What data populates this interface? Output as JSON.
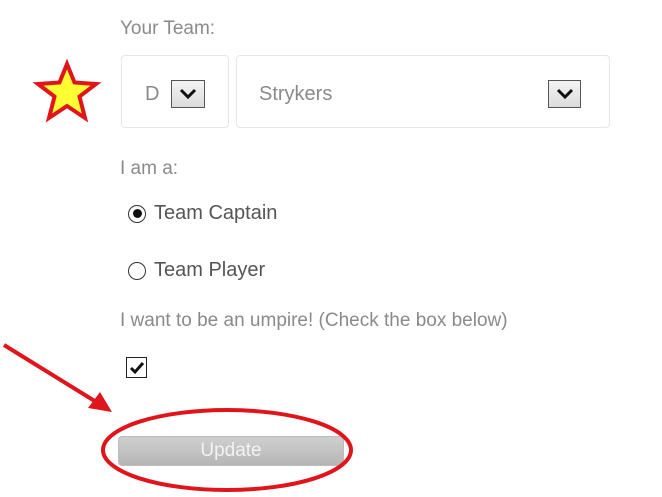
{
  "form": {
    "team_label": "Your Team:",
    "division_value": "D",
    "team_value": "Strykers",
    "role_label": "I am a:",
    "roles": [
      {
        "label": "Team Captain",
        "selected": true
      },
      {
        "label": "Team Player",
        "selected": false
      }
    ],
    "umpire_label": "I want to be an umpire! (Check the box below)",
    "umpire_checked": true,
    "update_label": "Update",
    "update_enabled": false
  },
  "annotations": {
    "star_color": "#ffff33",
    "star_outline_color": "#e0141b",
    "arrow_color": "#e0141b",
    "circle_color": "#e0141b"
  }
}
